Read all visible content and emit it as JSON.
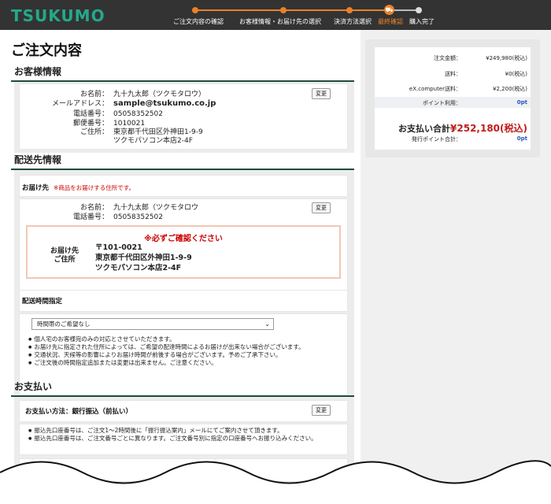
{
  "header": {
    "logo": "TSUKUMO",
    "steps": [
      {
        "label": "ご注文内容の確認",
        "state": "done"
      },
      {
        "label": "お客様情報・お届け先の選択",
        "state": "done"
      },
      {
        "label": "決済方法選択",
        "state": "done"
      },
      {
        "label": "最終確認",
        "state": "current"
      },
      {
        "label": "購入完了",
        "state": "todo"
      }
    ]
  },
  "page": {
    "title": "ご注文内容"
  },
  "customer": {
    "heading": "お客様情報",
    "change_label": "変更",
    "rows": [
      {
        "key": "お名前：",
        "value": "九十九太郎（ツクモタロウ）"
      },
      {
        "key": "メールアドレス：",
        "value": "sample@tsukumo.co.jp"
      },
      {
        "key": "電話番号：",
        "value": "05058352502"
      },
      {
        "key": "郵便番号：",
        "value": "1010021"
      },
      {
        "key": "ご住所：",
        "value": "東京都千代田区外神田1-9-9"
      },
      {
        "key": "",
        "value": "ツクモパソコン本店2-4F"
      }
    ]
  },
  "delivery": {
    "heading": "配送先情報",
    "dest_title": "お届け先",
    "dest_note": "※商品をお届けする住所です。",
    "change_label": "変更",
    "name_key": "お名前：",
    "name_value": "九十九太郎（ツクモタロウ",
    "phone_key": "電話番号：",
    "phone_value": "05058352502",
    "confirm_title": "※必ずご確認ください",
    "confirm_label": "お届け先 ご住所",
    "confirm_zip": "〒101-0021",
    "confirm_addr1": "東京都千代田区外神田1-9-9",
    "confirm_addr2": "ツクモパソコン本店2-4F",
    "time_title": "配送時間指定",
    "time_select": "時間帯のご希望なし",
    "notes": [
      "個人宅のお客様宛のみの対応とさせていただきます。",
      "お届け先に指定された住所によっては、ご希望の配達時間によるお届けが出来ない場合がございます。",
      "交通状況、天候等の影響によりお届け時間が前後する場合がございます。予めご了承下さい。",
      "ご注文後の時間指定追加または変更は出来ません。ご注意ください。"
    ]
  },
  "payment": {
    "heading": "お支払い",
    "method_title": "お支払い方法：銀行振込（前払い）",
    "change_label": "変更",
    "notes": [
      "振込先口座番号は、ご注文1～2時間後に「振行振込案内」メールにてご案内させて頂きます。",
      "振込先口座番号は、ご注文番号ごとに異なります。ご注文番号別に指定の口座番号へお振り込みください。"
    ]
  },
  "summary": {
    "rows": [
      {
        "key": "注文金額：",
        "value": "¥249,980(税込)"
      },
      {
        "key": "送料：",
        "value": "¥0(税込)"
      },
      {
        "key": "eX.computer送料：",
        "value": "¥2,200(税込)"
      },
      {
        "key": "ポイント利用：",
        "value": "0pt"
      }
    ],
    "total_key": "お支払い合計：",
    "total_value": "¥252,180(税込)",
    "points_key": "発行ポイント合計：",
    "points_value": "0pt"
  }
}
